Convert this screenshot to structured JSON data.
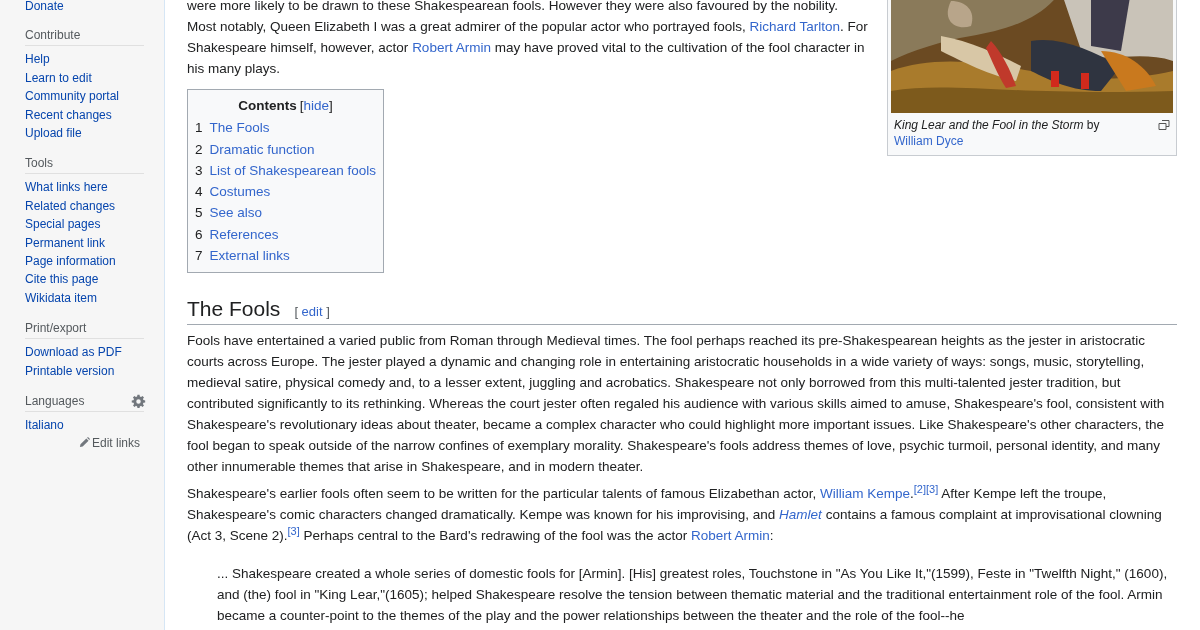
{
  "sidebar": {
    "top_link": "Donate",
    "sections": [
      {
        "kind": "plain",
        "heading": "Contribute",
        "links": [
          "Help",
          "Learn to edit",
          "Community portal",
          "Recent changes",
          "Upload file"
        ]
      },
      {
        "kind": "plain",
        "heading": "Tools",
        "links": [
          "What links here",
          "Related changes",
          "Special pages",
          "Permanent link",
          "Page information",
          "Cite this page",
          "Wikidata item"
        ]
      },
      {
        "kind": "plain",
        "heading": "Print/export",
        "links": [
          "Download as PDF",
          "Printable version"
        ]
      },
      {
        "kind": "languages",
        "heading": "Languages",
        "links": [
          "Italiano"
        ],
        "footer_link": "Edit links"
      }
    ]
  },
  "intro": [
    {
      "kind": "text",
      "text": "were more likely to be drawn to these Shakespearean fools. However they were also favoured by the nobility. Most notably, Queen Elizabeth I was a great admirer of the popular actor who portrayed fools, "
    },
    {
      "kind": "link",
      "text": "Richard Tarlton"
    },
    {
      "kind": "text",
      "text": ". For Shakespeare himself, however, actor "
    },
    {
      "kind": "link",
      "text": "Robert Armin"
    },
    {
      "kind": "text",
      "text": " may have proved vital to the cultivation of the fool character in his many plays."
    }
  ],
  "figure": {
    "caption": [
      {
        "kind": "italic",
        "text": "King Lear and the Fool in the Storm"
      },
      {
        "kind": "text",
        "text": " by "
      },
      {
        "kind": "link",
        "text": "William Dyce"
      }
    ]
  },
  "toc": {
    "title": "Contents",
    "toggle": {
      "open": "[",
      "label": "hide",
      "close": "]"
    },
    "items": [
      {
        "number": "1",
        "label": "The Fools"
      },
      {
        "number": "2",
        "label": "Dramatic function"
      },
      {
        "number": "3",
        "label": "List of Shakespearean fools"
      },
      {
        "number": "4",
        "label": "Costumes"
      },
      {
        "number": "5",
        "label": "See also"
      },
      {
        "number": "6",
        "label": "References"
      },
      {
        "number": "7",
        "label": "External links"
      }
    ]
  },
  "section": {
    "heading": "The Fools",
    "edit": {
      "open": "[",
      "label": "edit",
      "close": "]"
    },
    "paragraphs": [
      [
        {
          "kind": "text",
          "text": "Fools have entertained a varied public from Roman through Medieval times. The fool perhaps reached its pre-Shakespearean heights as the jester in aristocratic courts across Europe. The jester played a dynamic and changing role in entertaining aristocratic households in a wide variety of ways: songs, music, storytelling, medieval satire, physical comedy and, to a lesser extent, juggling and acrobatics. Shakespeare not only borrowed from this multi-talented jester tradition, but contributed significantly to its rethinking. Whereas the court jester often regaled his audience with various skills aimed to amuse, Shakespeare's fool, consistent with Shakespeare's revolutionary ideas about theater, became a complex character who could highlight more important issues. Like Shakespeare's other characters, the fool began to speak outside of the narrow confines of exemplary morality. Shakespeare's fools address themes of love, psychic turmoil, personal identity, and many other innumerable themes that arise in Shakespeare, and in modern theater."
        }
      ],
      [
        {
          "kind": "text",
          "text": "Shakespeare's earlier fools often seem to be written for the particular talents of famous Elizabethan actor, "
        },
        {
          "kind": "link",
          "text": "William Kempe"
        },
        {
          "kind": "text",
          "text": "."
        },
        {
          "kind": "ref",
          "text": "[2]"
        },
        {
          "kind": "ref",
          "text": "[3]"
        },
        {
          "kind": "text",
          "text": " After Kempe left the troupe, Shakespeare's comic characters changed dramatically. Kempe was known for his improvising, and "
        },
        {
          "kind": "italic_link",
          "text": "Hamlet"
        },
        {
          "kind": "text",
          "text": " contains a famous complaint at improvisational clowning (Act 3, Scene 2)."
        },
        {
          "kind": "ref",
          "text": "[3]"
        },
        {
          "kind": "text",
          "text": " Perhaps central to the Bard's redrawing of the fool was the actor "
        },
        {
          "kind": "link",
          "text": "Robert Armin"
        },
        {
          "kind": "text",
          "text": ":"
        }
      ]
    ],
    "quote": "... Shakespeare created a whole series of domestic fools for [Armin]. [His] greatest roles, Touchstone in \"As You Like It,\"(1599), Feste in \"Twelfth Night,\" (1600), and (the) fool in \"King Lear,\"(1605); helped Shakespeare resolve the tension between thematic material and the traditional entertainment role of the fool. Armin became a counter-point to the themes of the play and the power relationships between the theater and the role of the fool--he"
  }
}
